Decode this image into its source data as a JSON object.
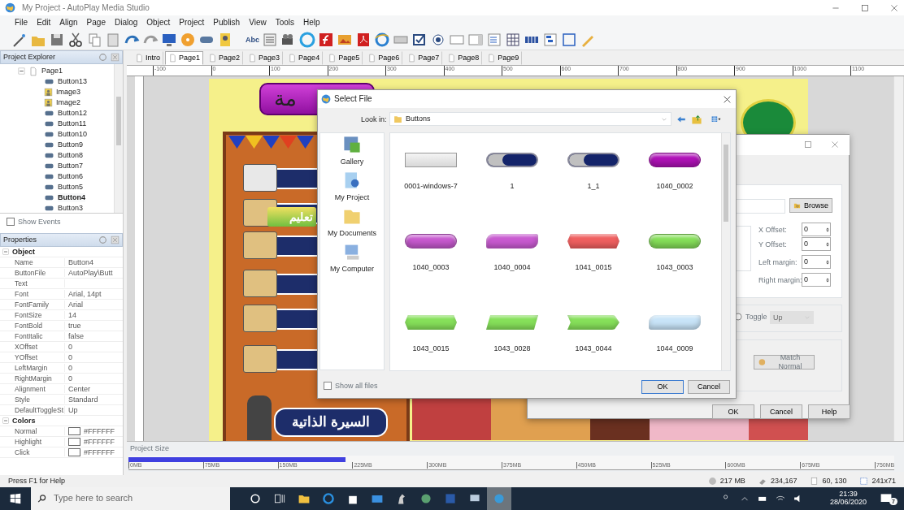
{
  "window": {
    "title": "My Project - AutoPlay Media Studio"
  },
  "menu": [
    "File",
    "Edit",
    "Align",
    "Page",
    "Dialog",
    "Object",
    "Project",
    "Publish",
    "View",
    "Tools",
    "Help"
  ],
  "toolbar": {
    "text_tool": "Abc"
  },
  "project_explorer": {
    "title": "Project Explorer",
    "tree": [
      {
        "label": "Page1",
        "expanded": true,
        "children": [
          {
            "label": "Button13",
            "kind": "button",
            "selected": false
          },
          {
            "label": "Image3",
            "kind": "image",
            "selected": false
          },
          {
            "label": "Image2",
            "kind": "image",
            "selected": false
          },
          {
            "label": "Button12",
            "kind": "button",
            "selected": false
          },
          {
            "label": "Button11",
            "kind": "button",
            "selected": false
          },
          {
            "label": "Button10",
            "kind": "button",
            "selected": false
          },
          {
            "label": "Button9",
            "kind": "button",
            "selected": false
          },
          {
            "label": "Button8",
            "kind": "button",
            "selected": false
          },
          {
            "label": "Button7",
            "kind": "button",
            "selected": false
          },
          {
            "label": "Button6",
            "kind": "button",
            "selected": false
          },
          {
            "label": "Button5",
            "kind": "button",
            "selected": false
          },
          {
            "label": "Button4",
            "kind": "button",
            "selected": true
          },
          {
            "label": "Button3",
            "kind": "button",
            "selected": false
          }
        ]
      }
    ],
    "show_events": {
      "label": "Show Events",
      "checked": false
    }
  },
  "properties": {
    "title": "Properties",
    "groups": [
      {
        "name": "Object",
        "expanded": true,
        "rows": [
          {
            "name": "Name",
            "value": "Button4"
          },
          {
            "name": "ButtonFile",
            "value": "AutoPlay\\Butt"
          },
          {
            "name": "Text",
            "value": ""
          },
          {
            "name": "Font",
            "value": "Arial, 14pt"
          },
          {
            "name": "FontFamily",
            "value": "Arial"
          },
          {
            "name": "FontSize",
            "value": "14"
          },
          {
            "name": "FontBold",
            "value": "true"
          },
          {
            "name": "FontItalic",
            "value": "false"
          },
          {
            "name": "XOffset",
            "value": "0"
          },
          {
            "name": "YOffset",
            "value": "0"
          },
          {
            "name": "LeftMargin",
            "value": "0"
          },
          {
            "name": "RightMargin",
            "value": "0"
          },
          {
            "name": "Alignment",
            "value": "Center"
          },
          {
            "name": "Style",
            "value": "Standard"
          },
          {
            "name": "DefaultToggleSt",
            "value": "Up"
          }
        ]
      },
      {
        "name": "Colors",
        "expanded": true,
        "rows": [
          {
            "name": "Normal",
            "value": "#FFFFFF",
            "color": "#ffffff"
          },
          {
            "name": "Highlight",
            "value": "#FFFFFF",
            "color": "#ffffff"
          },
          {
            "name": "Click",
            "value": "#FFFFFF",
            "color": "#ffffff"
          }
        ]
      }
    ]
  },
  "tabs": [
    {
      "label": "Intro",
      "selected": false
    },
    {
      "label": "Page1",
      "selected": true
    },
    {
      "label": "Page2",
      "selected": false
    },
    {
      "label": "Page3",
      "selected": false
    },
    {
      "label": "Page4",
      "selected": false
    },
    {
      "label": "Page5",
      "selected": false
    },
    {
      "label": "Page6",
      "selected": false
    },
    {
      "label": "Page7",
      "selected": false
    },
    {
      "label": "Page8",
      "selected": false
    },
    {
      "label": "Page9",
      "selected": false
    }
  ],
  "ruler_labels": [
    "-100",
    "0",
    "100",
    "200",
    "300",
    "400",
    "500",
    "600",
    "700",
    "800",
    "900",
    "1000",
    "1100"
  ],
  "canvas": {
    "labels": [
      {
        "text": "مة",
        "kind": "purple"
      },
      {
        "text": "تعليم",
        "kind": "green"
      },
      {
        "text": "السيرة الذاتية",
        "kind": "navy"
      }
    ]
  },
  "select_file": {
    "title": "Select File",
    "look_in_label": "Look in:",
    "folder": "Buttons",
    "places": [
      {
        "label": "Gallery",
        "kind": "gallery"
      },
      {
        "label": "My Project",
        "kind": "project"
      },
      {
        "label": "My Documents",
        "kind": "documents"
      },
      {
        "label": "My Computer",
        "kind": "computer"
      }
    ],
    "files": [
      {
        "name": "0001-windows-7",
        "kind": "plain",
        "color": "#d8d8d8"
      },
      {
        "name": "1",
        "kind": "navy",
        "color": "#14246a"
      },
      {
        "name": "1_1",
        "kind": "navy",
        "color": "#14246a"
      },
      {
        "name": "1040_0002",
        "kind": "pill",
        "color": "#b012b8"
      },
      {
        "name": "1040_0003",
        "kind": "pill",
        "color": "#c85ad0"
      },
      {
        "name": "1040_0004",
        "kind": "slant",
        "color": "#c85ad0"
      },
      {
        "name": "1041_0015",
        "kind": "hexagon",
        "color": "#ef5f5f"
      },
      {
        "name": "1043_0003",
        "kind": "pill",
        "color": "#86e05a"
      },
      {
        "name": "1043_0015",
        "kind": "hexagon",
        "color": "#86e05a"
      },
      {
        "name": "1043_0028",
        "kind": "parallelogram",
        "color": "#86e05a"
      },
      {
        "name": "1043_0044",
        "kind": "notch",
        "color": "#86e05a"
      },
      {
        "name": "1044_0009",
        "kind": "slant",
        "color": "#c8e4f8"
      }
    ],
    "show_all": {
      "label": "Show all files",
      "checked": false
    },
    "buttons": [
      "OK",
      "Cancel"
    ]
  },
  "button_dialog": {
    "browse": "Browse",
    "offsets": [
      {
        "label": "X Offset:",
        "value": "0"
      },
      {
        "label": "Y Offset:",
        "value": "0"
      },
      {
        "label": "Left margin:",
        "value": "0"
      },
      {
        "label": "Right margin:",
        "value": "0"
      }
    ],
    "toggle": {
      "label": "Toggle",
      "selected": false
    },
    "toggle_state": {
      "value": "Up",
      "disabled": true
    },
    "match": "Match Normal",
    "buttons": [
      "OK",
      "Cancel",
      "Help"
    ]
  },
  "project_size": {
    "title": "Project Size",
    "level": 0.29,
    "scale": [
      "0MB",
      "75MB",
      "150MB",
      "225MB",
      "300MB",
      "375MB",
      "450MB",
      "525MB",
      "600MB",
      "675MB",
      "750MB"
    ]
  },
  "status_bar": {
    "help": "Press F1 for Help",
    "size": "217 MB",
    "count": "234,167",
    "position": "60, 130",
    "dimensions": "241x71"
  },
  "taskbar": {
    "search_placeholder": "Type here to search",
    "time": "21:39",
    "date": "28/06/2020",
    "notifications": "7"
  }
}
